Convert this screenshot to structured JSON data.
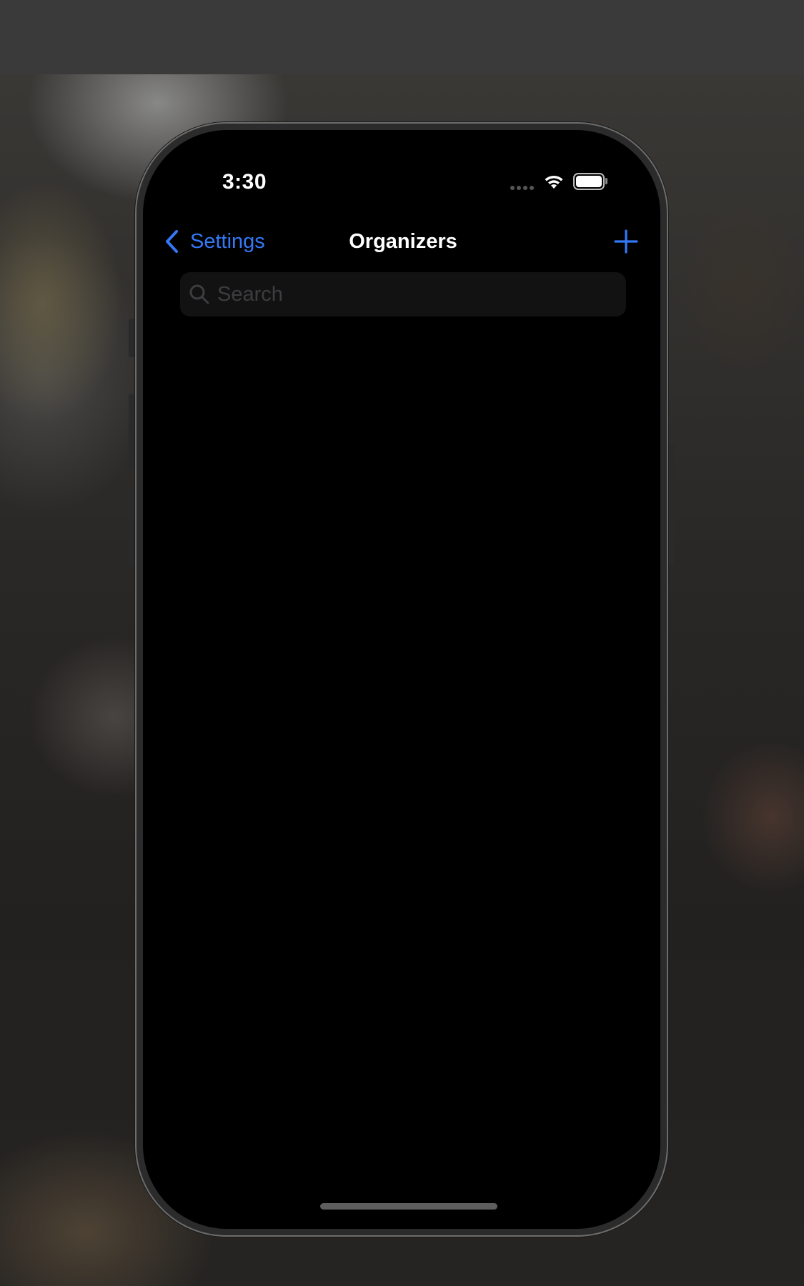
{
  "status_bar": {
    "time": "3:30",
    "signal_icon": "cellular-signal-icon",
    "wifi_icon": "wifi-icon",
    "battery_icon": "battery-icon",
    "battery_level": 1.0
  },
  "nav": {
    "back_label": "Settings",
    "back_icon": "chevron-left-icon",
    "title": "Organizers",
    "add_icon": "plus-icon"
  },
  "search": {
    "placeholder": "Search",
    "value": "",
    "icon": "magnifying-glass-icon"
  },
  "colors": {
    "accent": "#3478f6",
    "screen_background": "#000000",
    "search_background": "#121213",
    "placeholder": "#3d3d40"
  }
}
